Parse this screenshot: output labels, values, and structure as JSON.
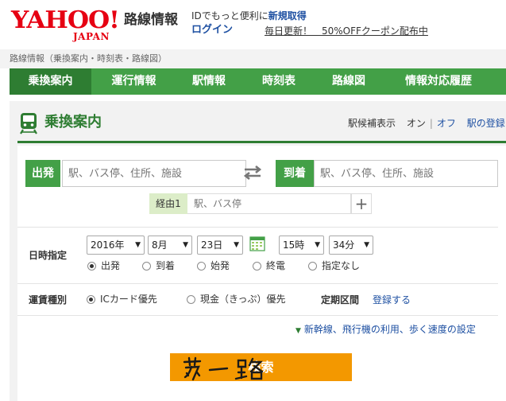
{
  "header": {
    "logo_text": "YAHOO!",
    "logo_sub": "JAPAN",
    "service_name": "路線情報",
    "id_text_prefix": "IDでもっと便利に",
    "id_register": "新規取得",
    "login": "ログイン",
    "promo": "毎日更新！　50%OFFクーポン配布中"
  },
  "breadcrumb": "路線情報（乗換案内・時刻表・路線図）",
  "nav": {
    "tabs": [
      {
        "label": "乗換案内",
        "active": true
      },
      {
        "label": "運行情報",
        "active": false
      },
      {
        "label": "駅情報",
        "active": false
      },
      {
        "label": "時刻表",
        "active": false
      },
      {
        "label": "路線図",
        "active": false
      },
      {
        "label": "情報対応履歴",
        "active": false
      }
    ]
  },
  "section": {
    "title": "乗換案内",
    "suggest_label": "駅候補表示",
    "on": "オン",
    "sep": "|",
    "off": "オフ",
    "register_link": "駅の登録"
  },
  "form": {
    "departure_label": "出発",
    "departure_placeholder": "駅、バス停、住所、施設",
    "arrival_label": "到着",
    "arrival_placeholder": "駅、バス停、住所、施設",
    "via_label": "経由1",
    "via_placeholder": "駅、バス停",
    "via_add": "+",
    "datetime_label": "日時指定",
    "year": "2016年",
    "month": "8月",
    "day": "23日",
    "hour": "15時",
    "minute": "34分",
    "time_options": [
      {
        "label": "出発",
        "selected": true
      },
      {
        "label": "到着",
        "selected": false
      },
      {
        "label": "始発",
        "selected": false
      },
      {
        "label": "終電",
        "selected": false
      },
      {
        "label": "指定なし",
        "selected": false
      }
    ],
    "fare_label": "運賃種別",
    "fare_options": [
      {
        "label": "ICカード優先",
        "selected": true
      },
      {
        "label": "現金（きっぷ）優先",
        "selected": false
      }
    ],
    "teiki_label": "定期区間",
    "teiki_link": "登録する",
    "options_link": "新幹線、飛行機の利用、歩く速度の設定",
    "search_button": "検索",
    "handwriting": "苏一路"
  },
  "colors": {
    "brand_red": "#e60012",
    "nav_green": "#43a047",
    "dark_green": "#2e7d32",
    "search_orange": "#f39800",
    "link_blue": "#1e50a2"
  }
}
